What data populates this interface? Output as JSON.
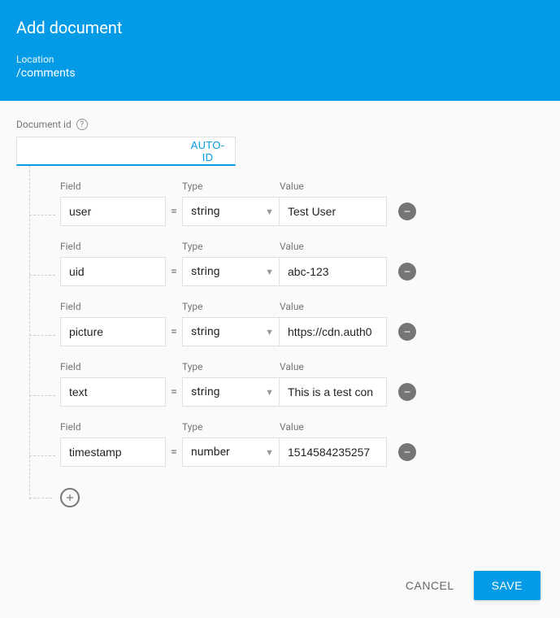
{
  "header": {
    "title": "Add document",
    "location_label": "Location",
    "location_path": "/comments"
  },
  "docid": {
    "label": "Document id",
    "value": "",
    "auto_id_label": "AUTO-ID"
  },
  "column_labels": {
    "field": "Field",
    "type": "Type",
    "value": "Value"
  },
  "eq": "=",
  "fields": [
    {
      "name": "user",
      "type": "string",
      "value": "Test User"
    },
    {
      "name": "uid",
      "type": "string",
      "value": "abc-123"
    },
    {
      "name": "picture",
      "type": "string",
      "value": "https://cdn.auth0"
    },
    {
      "name": "text",
      "type": "string",
      "value": "This is a test con"
    },
    {
      "name": "timestamp",
      "type": "number",
      "value": "1514584235257"
    }
  ],
  "footer": {
    "cancel": "CANCEL",
    "save": "SAVE"
  }
}
